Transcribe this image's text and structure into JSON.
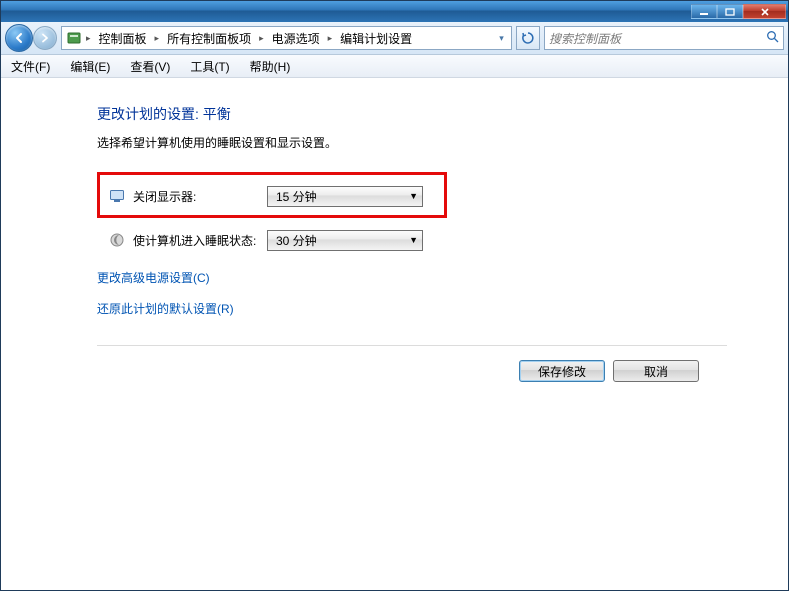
{
  "window_controls": {
    "minimize": "minimize",
    "maximize": "maximize",
    "close": "close"
  },
  "breadcrumb": {
    "items": [
      "控制面板",
      "所有控制面板项",
      "电源选项",
      "编辑计划设置"
    ]
  },
  "search": {
    "placeholder": "搜索控制面板"
  },
  "menu": {
    "file": "文件(F)",
    "edit": "编辑(E)",
    "view": "查看(V)",
    "tools": "工具(T)",
    "help": "帮助(H)"
  },
  "page": {
    "title": "更改计划的设置: 平衡",
    "subtitle": "选择希望计算机使用的睡眠设置和显示设置。",
    "settings": {
      "turn_off_display": {
        "label": "关闭显示器:",
        "value": "15 分钟"
      },
      "sleep": {
        "label": "使计算机进入睡眠状态:",
        "value": "30 分钟"
      }
    },
    "links": {
      "advanced": "更改高级电源设置(C)",
      "restore": "还原此计划的默认设置(R)"
    },
    "buttons": {
      "save": "保存修改",
      "cancel": "取消"
    }
  }
}
